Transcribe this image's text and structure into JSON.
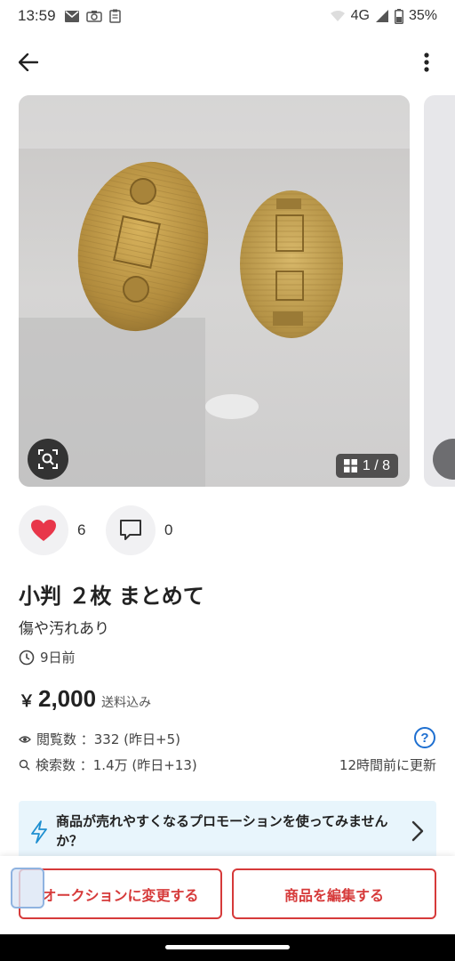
{
  "status_bar": {
    "time": "13:59",
    "network": "4G",
    "battery": "35%"
  },
  "photos": {
    "counter": "1 / 8",
    "current": 1,
    "total": 8
  },
  "reactions": {
    "likes": "6",
    "comments": "0"
  },
  "item": {
    "title": "小判 ２枚 まとめて",
    "condition": "傷や汚れあり",
    "posted": "9日前",
    "currency": "￥",
    "price": "2,000",
    "shipping": "送料込み"
  },
  "stats": {
    "views": "閲覧数 ：332 (昨日+5)",
    "searches": "検索数 ：1.4万 (昨日+13)",
    "updated": "12時間前に更新"
  },
  "promo": {
    "text": "商品が売れやすくなるプロモーションを使ってみませんか？"
  },
  "actions": {
    "auction_label": "オークションに変更する",
    "edit_label": "商品を編集する"
  },
  "colors": {
    "accent_red": "#d63a3a",
    "heart": "#e8364a",
    "link_blue": "#1e6fd0",
    "promo_bg": "#e8f5fc"
  },
  "icons": [
    "mail-icon",
    "camera-icon",
    "clipboard-icon",
    "wifi-icon",
    "signal-icon",
    "battery-icon",
    "back-arrow-icon",
    "more-vert-icon",
    "lens-search-icon",
    "grid-icon",
    "heart-icon",
    "comment-icon",
    "clock-icon",
    "eye-icon",
    "search-icon",
    "help-icon",
    "bolt-icon",
    "chevron-right-icon"
  ]
}
